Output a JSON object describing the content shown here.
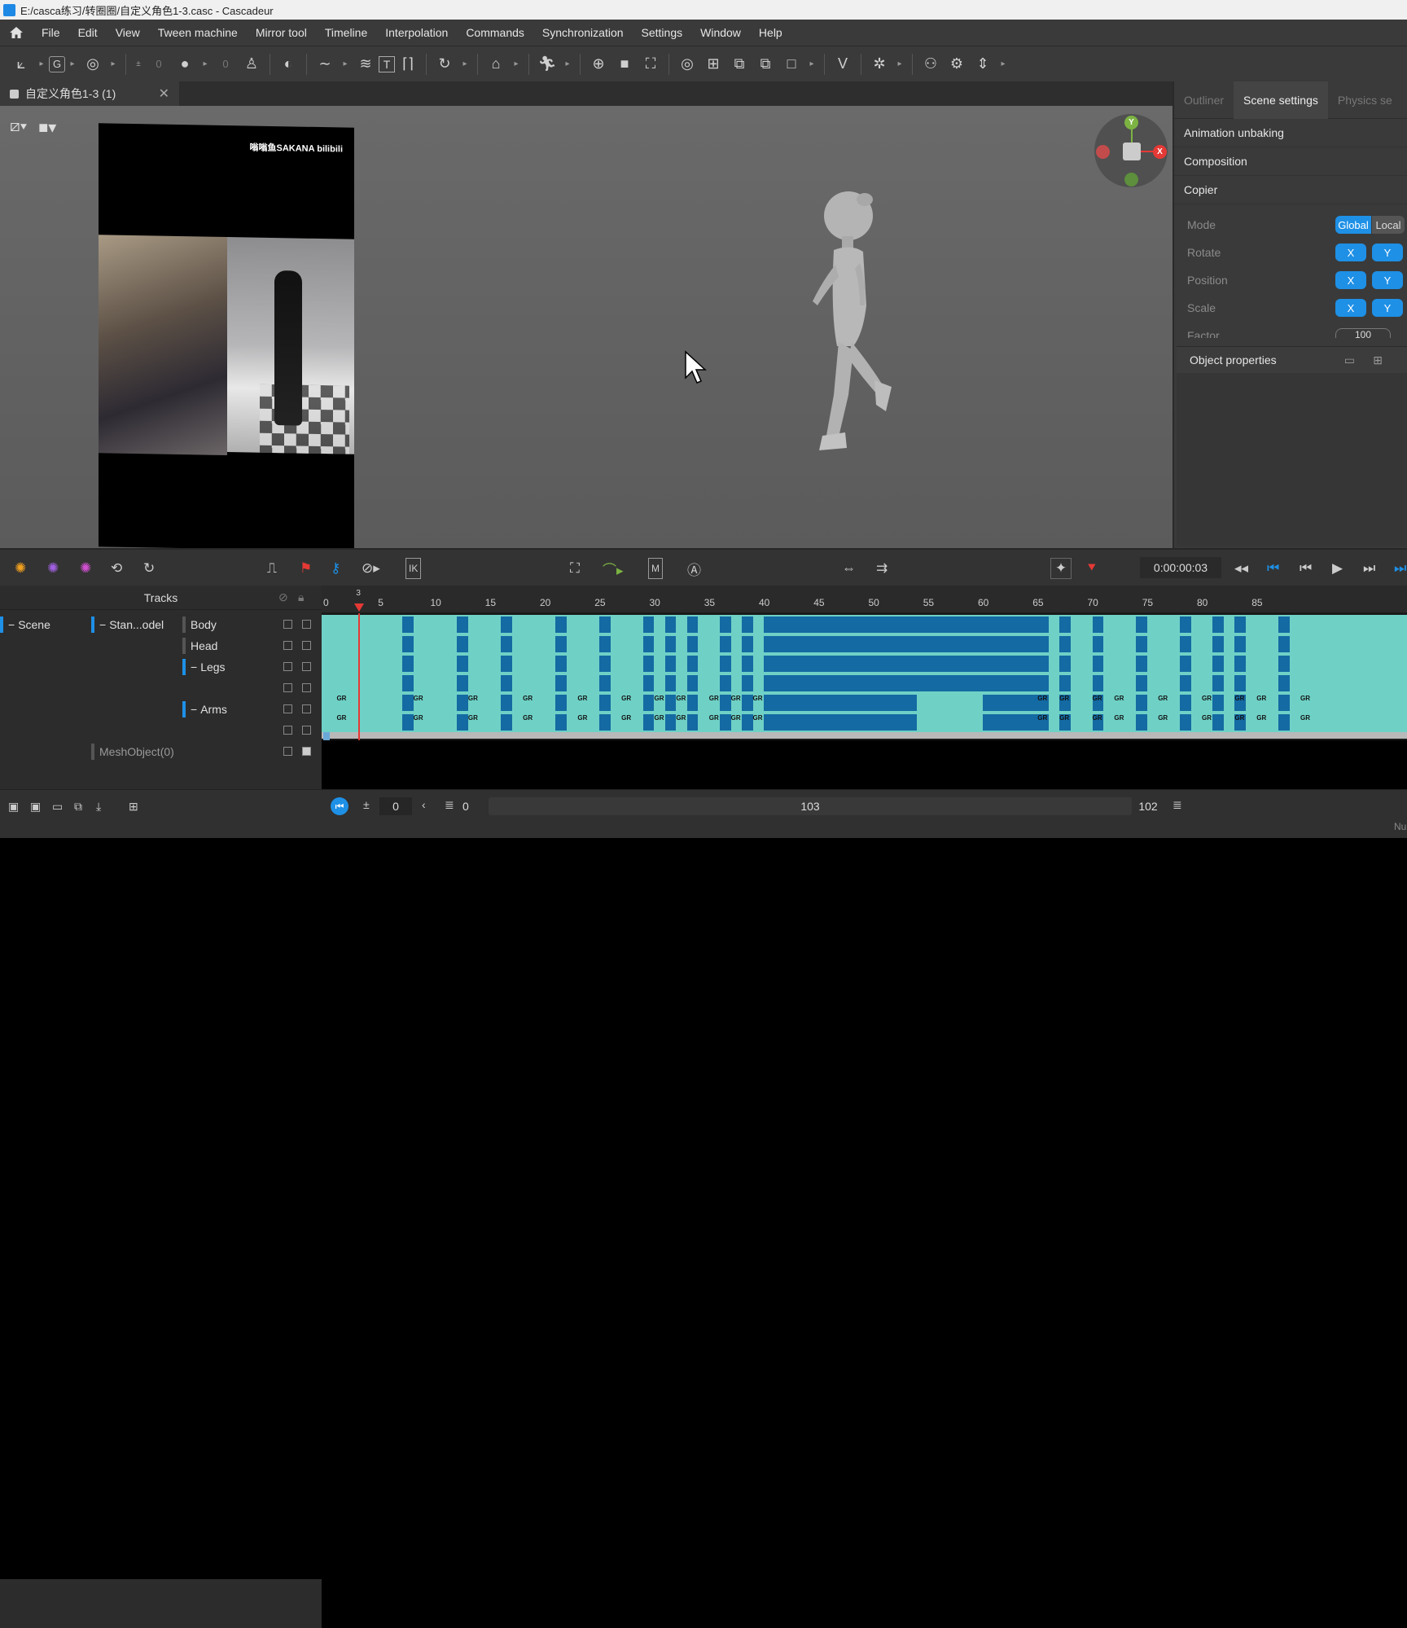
{
  "window": {
    "title": "E:/casca练习/转圈圈/自定义角色1-3.casc - Cascadeur"
  },
  "menu": [
    "File",
    "Edit",
    "View",
    "Tween machine",
    "Mirror tool",
    "Timeline",
    "Interpolation",
    "Commands",
    "Synchronization",
    "Settings",
    "Window",
    "Help"
  ],
  "toolbar": {
    "frame_value_a": "0",
    "frame_value_b": "0"
  },
  "document_tab": {
    "label": "自定义角色1-3 (1)"
  },
  "reference": {
    "watermark": "嗡嗡鱼SAKANA bilibili"
  },
  "gizmo": {
    "y": "Y",
    "x": "X"
  },
  "right_panel": {
    "tabs": [
      "Outliner",
      "Scene settings",
      "Physics se"
    ],
    "active_tab": "Scene settings",
    "sections": [
      "Animation unbaking",
      "Composition",
      "Copier"
    ],
    "copier": {
      "mode_label": "Mode",
      "mode_global": "Global",
      "mode_local": "Local",
      "rotate_label": "Rotate",
      "position_label": "Position",
      "scale_label": "Scale",
      "factor_label": "Factor",
      "factor_value": "100",
      "axis_x": "X",
      "axis_y": "Y"
    },
    "object_properties": "Object properties"
  },
  "timeline": {
    "current_time": "0:00:00:03",
    "tracks_header": "Tracks",
    "tree": {
      "scene": "Scene",
      "model": "Stan...odel",
      "body": "Body",
      "head": "Head",
      "legs": "Legs",
      "arms": "Arms",
      "mesh": "MeshObject(0)"
    },
    "ruler": [
      "0",
      "3",
      "5",
      "10",
      "15",
      "20",
      "25",
      "30",
      "35",
      "40",
      "45",
      "50",
      "55",
      "60",
      "65",
      "70",
      "75",
      "80",
      "85"
    ],
    "keyframe_tag": "GR",
    "range_start": "0",
    "range_in": "0",
    "range_length": "103",
    "range_end": "102",
    "status_right": "Nu"
  },
  "colors": {
    "accent": "#1e90e6",
    "key_light": "#6fd1c6",
    "key_dark": "#146aa2",
    "playhead": "#e53935"
  }
}
